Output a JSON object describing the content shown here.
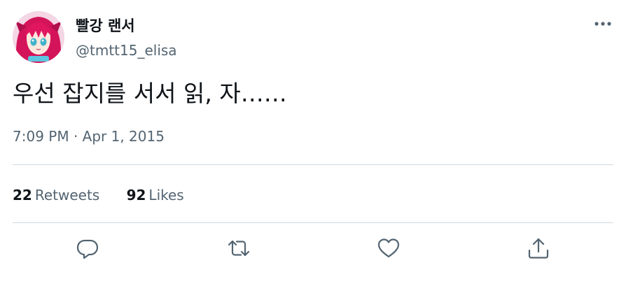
{
  "user": {
    "display_name": "빨강 랜서",
    "handle": "@tmtt15_elisa"
  },
  "tweet": {
    "text": "우선 잡지를 서서 읽, 자……",
    "meta": "7:09 PM · Apr 1, 2015"
  },
  "stats": {
    "retweets_count": "22",
    "retweets_label": "Retweets",
    "likes_count": "92",
    "likes_label": "Likes"
  },
  "colors": {
    "text": "#0f1419",
    "secondary": "#536471",
    "divider": "#cfd9de"
  },
  "icons": {
    "more": "more-icon",
    "reply": "reply-icon",
    "retweet": "retweet-icon",
    "like": "like-icon",
    "share": "share-icon"
  }
}
